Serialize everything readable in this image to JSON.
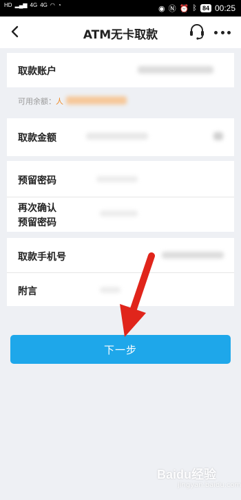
{
  "status_bar": {
    "left_labels": [
      "HD",
      "4G",
      "4G"
    ],
    "battery": "84",
    "time": "00:25"
  },
  "nav": {
    "title": "ATM无卡取款",
    "icons": [
      "back-arrow",
      "headset",
      "more-dots"
    ]
  },
  "form": {
    "account_label": "取款账户",
    "balance_hint_prefix": "可用余额：",
    "balance_hint_value": "人",
    "amount_label": "取款金额",
    "password_label": "预留密码",
    "confirm_label_line1": "再次确认",
    "confirm_label_line2": "预留密码",
    "phone_label": "取款手机号",
    "note_label": "附言"
  },
  "button": {
    "next_label": "下一步"
  },
  "watermark": {
    "brand": "Baidu经验",
    "sub": "jingyan.baidu.com"
  },
  "colors": {
    "primary_button": "#1ea7ea",
    "hint_warn": "#f08a24",
    "annotation_arrow": "#e0251b"
  }
}
